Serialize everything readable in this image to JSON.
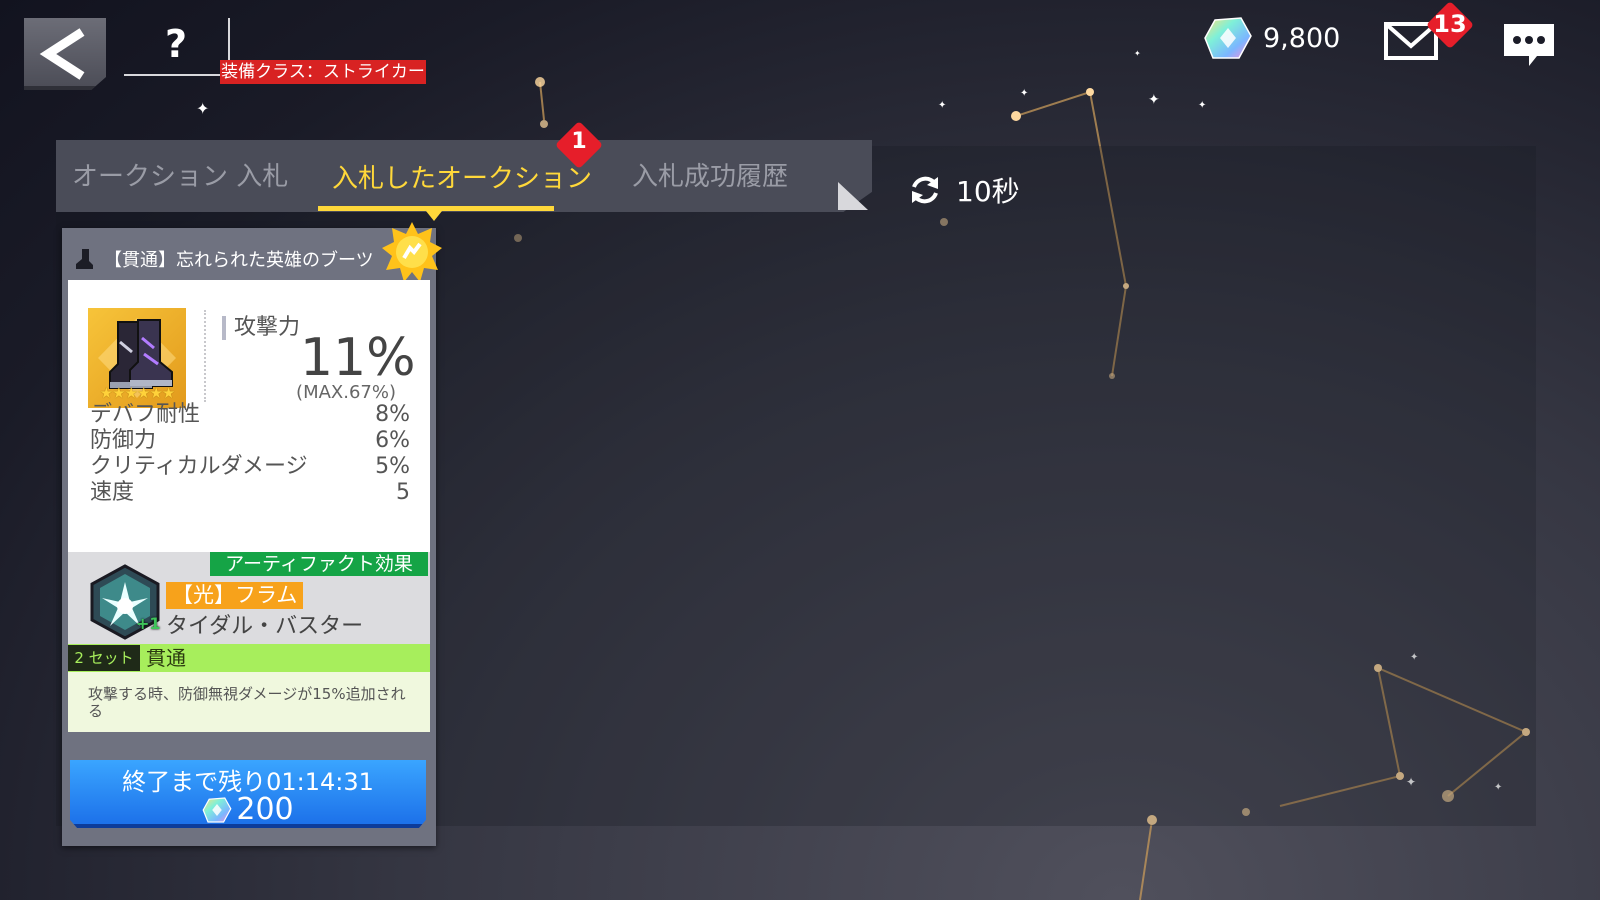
{
  "header": {
    "back_icon": "back-arrow-icon",
    "help_label": "?",
    "currency": {
      "icon": "crystal-gem-icon",
      "amount": "9,800"
    },
    "mail": {
      "icon": "mail-envelope-icon",
      "badge": "13"
    },
    "chat": {
      "icon": "chat-bubble-icon"
    }
  },
  "tabs": [
    {
      "label": "オークション 入札",
      "active": false
    },
    {
      "label": "入札したオークション",
      "active": true,
      "badge": "1"
    },
    {
      "label": "入札成功履歴",
      "active": false
    }
  ],
  "refresh": {
    "icon": "refresh-icon",
    "label": "10秒"
  },
  "item": {
    "title": "【貫通】忘れられた英雄のブーツ",
    "slot_icon": "boots-slot-icon",
    "class_tag": "装備クラス：ストライカー",
    "stars": "★★★★★★",
    "main_stat": {
      "label": "攻撃力",
      "value": "11%",
      "max": "(MAX.67%)"
    },
    "substats": [
      {
        "name": "デバフ耐性",
        "value": "8%"
      },
      {
        "name": "防御力",
        "value": "6%"
      },
      {
        "name": "クリティカルダメージ",
        "value": "5%"
      },
      {
        "name": "速度",
        "value": "5"
      }
    ],
    "artifact": {
      "tag": "アーティファクト効果",
      "name": "【光】フラム",
      "skill": "タイダル・バスター",
      "level": "+1"
    },
    "set": {
      "count": "2 セット",
      "name": "貫通",
      "description": "攻撃する時、防御無視ダメージが15%追加される"
    },
    "bid": {
      "time_label": "終了まで残り01:14:31",
      "price": "200"
    }
  },
  "colors": {
    "tab_active": "#ffd83a",
    "badge_red": "#e61e2a",
    "class_red": "#d82222",
    "artifact_green": "#15a446",
    "set_green": "#a7ee5c",
    "bid_blue": "#1b6ee8"
  }
}
